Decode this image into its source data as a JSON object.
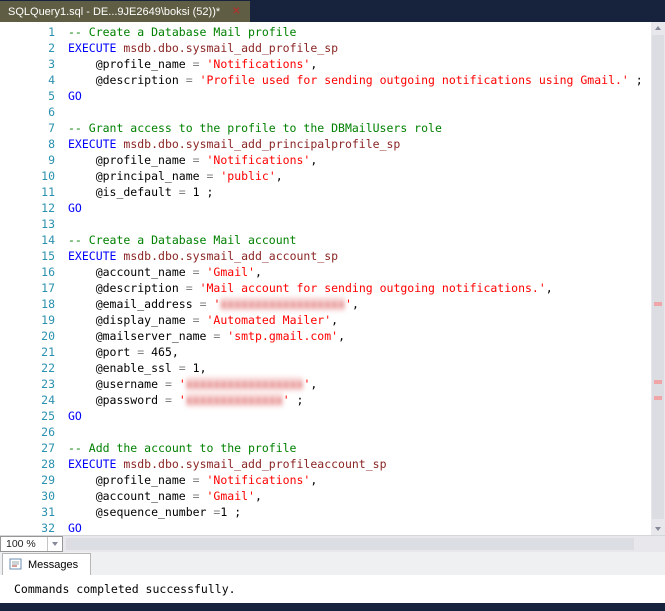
{
  "window": {
    "tab_title": "SQLQuery1.sql - DE...9JE2649\\boksi (52))*",
    "close_icon": "✕"
  },
  "zoom": {
    "value": "100 %"
  },
  "results": {
    "tab_label": "Messages",
    "message": "Commands completed successfully."
  },
  "colors": {
    "tabstrip_bg": "#17233d",
    "active_tab_bg": "#5f5d43",
    "comment": "#008000",
    "keyword": "#0000ff",
    "string": "#ff0000",
    "system_procedure": "#8b2525",
    "operator": "#808080",
    "line_number": "#2b91af"
  },
  "editor": {
    "lines": [
      {
        "n": 1,
        "tokens": [
          {
            "t": "comment",
            "v": "-- Create a Database Mail profile"
          }
        ]
      },
      {
        "n": 2,
        "tokens": [
          {
            "t": "kw",
            "v": "EXECUTE"
          },
          {
            "t": "plain",
            "v": " "
          },
          {
            "t": "proc",
            "v": "msdb.dbo.sysmail_add_profile_sp"
          }
        ]
      },
      {
        "n": 3,
        "tokens": [
          {
            "t": "plain",
            "v": "    @profile_name "
          },
          {
            "t": "op",
            "v": "="
          },
          {
            "t": "plain",
            "v": " "
          },
          {
            "t": "str",
            "v": "'Notifications'"
          },
          {
            "t": "plain",
            "v": ","
          }
        ]
      },
      {
        "n": 4,
        "tokens": [
          {
            "t": "plain",
            "v": "    @description "
          },
          {
            "t": "op",
            "v": "="
          },
          {
            "t": "plain",
            "v": " "
          },
          {
            "t": "str",
            "v": "'Profile used for sending outgoing notifications using Gmail.'"
          },
          {
            "t": "plain",
            "v": " ;"
          }
        ]
      },
      {
        "n": 5,
        "tokens": [
          {
            "t": "kw",
            "v": "GO"
          }
        ]
      },
      {
        "n": 6,
        "tokens": []
      },
      {
        "n": 7,
        "tokens": [
          {
            "t": "comment",
            "v": "-- Grant access to the profile to the DBMailUsers role"
          }
        ]
      },
      {
        "n": 8,
        "tokens": [
          {
            "t": "kw",
            "v": "EXECUTE"
          },
          {
            "t": "plain",
            "v": " "
          },
          {
            "t": "proc",
            "v": "msdb.dbo.sysmail_add_principalprofile_sp"
          }
        ]
      },
      {
        "n": 9,
        "tokens": [
          {
            "t": "plain",
            "v": "    @profile_name "
          },
          {
            "t": "op",
            "v": "="
          },
          {
            "t": "plain",
            "v": " "
          },
          {
            "t": "str",
            "v": "'Notifications'"
          },
          {
            "t": "plain",
            "v": ","
          }
        ]
      },
      {
        "n": 10,
        "tokens": [
          {
            "t": "plain",
            "v": "    @principal_name "
          },
          {
            "t": "op",
            "v": "="
          },
          {
            "t": "plain",
            "v": " "
          },
          {
            "t": "str",
            "v": "'public'"
          },
          {
            "t": "plain",
            "v": ","
          }
        ]
      },
      {
        "n": 11,
        "tokens": [
          {
            "t": "plain",
            "v": "    @is_default "
          },
          {
            "t": "op",
            "v": "="
          },
          {
            "t": "plain",
            "v": " "
          },
          {
            "t": "num",
            "v": "1"
          },
          {
            "t": "plain",
            "v": " ;"
          }
        ]
      },
      {
        "n": 12,
        "tokens": [
          {
            "t": "kw",
            "v": "GO"
          }
        ]
      },
      {
        "n": 13,
        "tokens": []
      },
      {
        "n": 14,
        "tokens": [
          {
            "t": "comment",
            "v": "-- Create a Database Mail account"
          }
        ]
      },
      {
        "n": 15,
        "tokens": [
          {
            "t": "kw",
            "v": "EXECUTE"
          },
          {
            "t": "plain",
            "v": " "
          },
          {
            "t": "proc",
            "v": "msdb.dbo.sysmail_add_account_sp"
          }
        ]
      },
      {
        "n": 16,
        "tokens": [
          {
            "t": "plain",
            "v": "    @account_name "
          },
          {
            "t": "op",
            "v": "="
          },
          {
            "t": "plain",
            "v": " "
          },
          {
            "t": "str",
            "v": "'Gmail'"
          },
          {
            "t": "plain",
            "v": ","
          }
        ]
      },
      {
        "n": 17,
        "tokens": [
          {
            "t": "plain",
            "v": "    @description "
          },
          {
            "t": "op",
            "v": "="
          },
          {
            "t": "plain",
            "v": " "
          },
          {
            "t": "str",
            "v": "'Mail account for sending outgoing notifications.'"
          },
          {
            "t": "plain",
            "v": ","
          }
        ]
      },
      {
        "n": 18,
        "tokens": [
          {
            "t": "plain",
            "v": "    @email_address "
          },
          {
            "t": "op",
            "v": "="
          },
          {
            "t": "plain",
            "v": " "
          },
          {
            "t": "str",
            "v": "'"
          },
          {
            "t": "redacted",
            "v": "xxxxxxxxxxxxxxxxxx"
          },
          {
            "t": "str",
            "v": "'"
          },
          {
            "t": "plain",
            "v": ","
          }
        ]
      },
      {
        "n": 19,
        "tokens": [
          {
            "t": "plain",
            "v": "    @display_name "
          },
          {
            "t": "op",
            "v": "="
          },
          {
            "t": "plain",
            "v": " "
          },
          {
            "t": "str",
            "v": "'Automated Mailer'"
          },
          {
            "t": "plain",
            "v": ","
          }
        ]
      },
      {
        "n": 20,
        "tokens": [
          {
            "t": "plain",
            "v": "    @mailserver_name "
          },
          {
            "t": "op",
            "v": "="
          },
          {
            "t": "plain",
            "v": " "
          },
          {
            "t": "str",
            "v": "'smtp.gmail.com'"
          },
          {
            "t": "plain",
            "v": ","
          }
        ]
      },
      {
        "n": 21,
        "tokens": [
          {
            "t": "plain",
            "v": "    @port "
          },
          {
            "t": "op",
            "v": "="
          },
          {
            "t": "plain",
            "v": " "
          },
          {
            "t": "num",
            "v": "465"
          },
          {
            "t": "plain",
            "v": ","
          }
        ]
      },
      {
        "n": 22,
        "tokens": [
          {
            "t": "plain",
            "v": "    @enable_ssl "
          },
          {
            "t": "op",
            "v": "="
          },
          {
            "t": "plain",
            "v": " "
          },
          {
            "t": "num",
            "v": "1"
          },
          {
            "t": "plain",
            "v": ","
          }
        ]
      },
      {
        "n": 23,
        "tokens": [
          {
            "t": "plain",
            "v": "    @username "
          },
          {
            "t": "op",
            "v": "="
          },
          {
            "t": "plain",
            "v": " "
          },
          {
            "t": "str",
            "v": "'"
          },
          {
            "t": "redacted",
            "v": "xxxxxxxxxxxxxxxxx"
          },
          {
            "t": "str",
            "v": "'"
          },
          {
            "t": "plain",
            "v": ","
          }
        ]
      },
      {
        "n": 24,
        "tokens": [
          {
            "t": "plain",
            "v": "    @password "
          },
          {
            "t": "op",
            "v": "="
          },
          {
            "t": "plain",
            "v": " "
          },
          {
            "t": "str",
            "v": "'"
          },
          {
            "t": "redacted",
            "v": "xxxxxxxxxxxxxx"
          },
          {
            "t": "str",
            "v": "'"
          },
          {
            "t": "plain",
            "v": " ;"
          }
        ]
      },
      {
        "n": 25,
        "tokens": [
          {
            "t": "kw",
            "v": "GO"
          }
        ]
      },
      {
        "n": 26,
        "tokens": []
      },
      {
        "n": 27,
        "tokens": [
          {
            "t": "comment",
            "v": "-- Add the account to the profile"
          }
        ]
      },
      {
        "n": 28,
        "tokens": [
          {
            "t": "kw",
            "v": "EXECUTE"
          },
          {
            "t": "plain",
            "v": " "
          },
          {
            "t": "proc",
            "v": "msdb.dbo.sysmail_add_profileaccount_sp"
          }
        ]
      },
      {
        "n": 29,
        "tokens": [
          {
            "t": "plain",
            "v": "    @profile_name "
          },
          {
            "t": "op",
            "v": "="
          },
          {
            "t": "plain",
            "v": " "
          },
          {
            "t": "str",
            "v": "'Notifications'"
          },
          {
            "t": "plain",
            "v": ","
          }
        ]
      },
      {
        "n": 30,
        "tokens": [
          {
            "t": "plain",
            "v": "    @account_name "
          },
          {
            "t": "op",
            "v": "="
          },
          {
            "t": "plain",
            "v": " "
          },
          {
            "t": "str",
            "v": "'Gmail'"
          },
          {
            "t": "plain",
            "v": ","
          }
        ]
      },
      {
        "n": 31,
        "tokens": [
          {
            "t": "plain",
            "v": "    @sequence_number "
          },
          {
            "t": "op",
            "v": "="
          },
          {
            "t": "num",
            "v": "1"
          },
          {
            "t": "plain",
            "v": " ;"
          }
        ]
      },
      {
        "n": 32,
        "tokens": [
          {
            "t": "kw",
            "v": "GO"
          }
        ]
      }
    ]
  }
}
